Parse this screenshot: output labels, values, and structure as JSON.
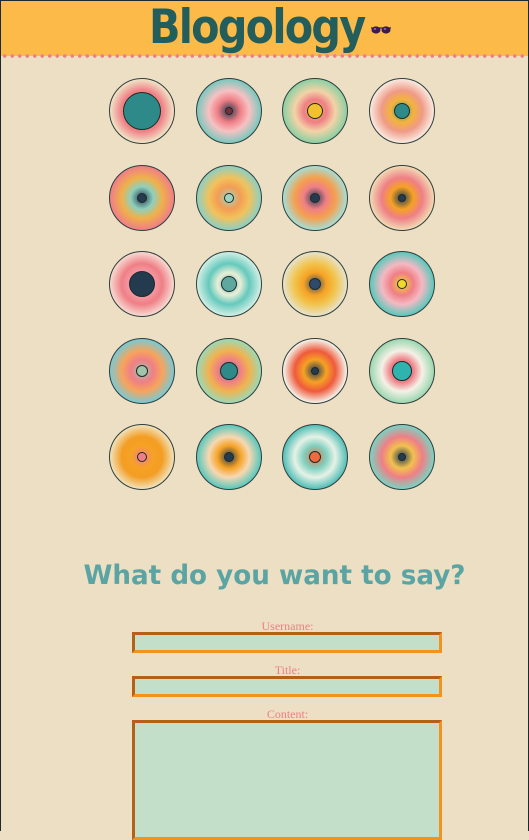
{
  "site": {
    "logo_text": "Blogology"
  },
  "gallery": {
    "discs": [
      {
        "c": [
          "#2e8a88",
          "#f3b43a",
          "#ef7f86",
          "#f1e2c5",
          "#9ed8c3"
        ],
        "core": "#2e8a88"
      },
      {
        "c": [
          "#243a4e",
          "#ef7f86",
          "#f7c1c2",
          "#7ec8be",
          "#2e8a88"
        ],
        "core": "#7a2e3c"
      },
      {
        "c": [
          "#f2c12e",
          "#ef7f86",
          "#f3d3a6",
          "#8fd0a3",
          "#3c8e7a"
        ],
        "core": "#f2c12e"
      },
      {
        "c": [
          "#2e8a88",
          "#f3b43a",
          "#ef9a86",
          "#f9e8de",
          "#8fcfc4"
        ],
        "core": "#2e8a88"
      },
      {
        "c": [
          "#243a4e",
          "#8ed0be",
          "#f0b14a",
          "#ef7f86",
          "#6b8f83"
        ],
        "core": "#243a4e"
      },
      {
        "c": [
          "#9fd4c0",
          "#f39d54",
          "#f2c25c",
          "#8fcfc0",
          "#ef7f86"
        ],
        "core": "#9fd4c0"
      },
      {
        "c": [
          "#243a4e",
          "#ef7f86",
          "#f5a04e",
          "#a8dcd2",
          "#4f8f86"
        ],
        "core": "#243a4e"
      },
      {
        "c": [
          "#243a4e",
          "#f6a224",
          "#ef7f86",
          "#f2d8b2",
          "#6fc7a4"
        ],
        "core": "#243a4e"
      },
      {
        "c": [
          "#243a4e",
          "#f59eaa",
          "#ef7f86",
          "#f7d8cf",
          "#ef6b6b"
        ],
        "core": "#243a4e"
      },
      {
        "c": [
          "#5fa8a0",
          "#e8efd8",
          "#65c9bd",
          "#cfeee3",
          "#38b3a8"
        ],
        "core": "#5fa8a0"
      },
      {
        "c": [
          "#2f4a6a",
          "#f6a224",
          "#f2c34a",
          "#e7e2c8",
          "#4a7a6a"
        ],
        "core": "#2f4a6a"
      },
      {
        "c": [
          "#f1d92c",
          "#ef7f86",
          "#f5b9c2",
          "#5ec8bc",
          "#247a86"
        ],
        "core": "#f1d92c"
      },
      {
        "c": [
          "#9fc6a8",
          "#ef7f86",
          "#f7a45c",
          "#7ec8d0",
          "#2f5a7a"
        ],
        "core": "#9fc6a8"
      },
      {
        "c": [
          "#2e8a88",
          "#ef7f86",
          "#f2b24e",
          "#9ed8b2",
          "#5b8f7a"
        ],
        "core": "#2e8a88"
      },
      {
        "c": [
          "#243a4e",
          "#f6a224",
          "#ef5a3c",
          "#f4f1e8",
          "#2e8aa8"
        ],
        "core": "#243a4e"
      },
      {
        "c": [
          "#2fb3ae",
          "#ef7f86",
          "#f5f1e6",
          "#9ed8b2",
          "#ef7f86"
        ],
        "core": "#2fb3ae"
      },
      {
        "c": [
          "#ef7f86",
          "#f6a224",
          "#f39d24",
          "#f2e0b6",
          "#2ea6a8"
        ],
        "core": "#ef7f86"
      },
      {
        "c": [
          "#243a4e",
          "#f6a224",
          "#f7d8b2",
          "#5ec8bc",
          "#2e6a6a"
        ],
        "core": "#243a4e"
      },
      {
        "c": [
          "#ef6b3c",
          "#7fd0c0",
          "#e7f2e6",
          "#56c0b8",
          "#2e8a88"
        ],
        "core": "#ef6b3c"
      },
      {
        "c": [
          "#243a4e",
          "#f2c24e",
          "#ef7f86",
          "#7fd0c0",
          "#2e8a88"
        ],
        "core": "#243a4e"
      }
    ]
  },
  "form": {
    "heading": "What do you want to say?",
    "username_label": "Username:",
    "title_label": "Title:",
    "content_label": "Content:",
    "username_value": "",
    "title_value": "",
    "content_value": ""
  }
}
